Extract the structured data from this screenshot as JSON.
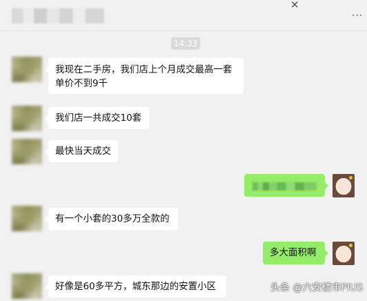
{
  "chat": {
    "timestamp": "14:33",
    "messages": [
      {
        "side": "left",
        "text": "我现在二手房，我们店上个月成交最高一套\n单价不到9千"
      },
      {
        "side": "left",
        "text": "我们店一共成交10套"
      },
      {
        "side": "left",
        "text": "最快当天成交"
      },
      {
        "side": "right",
        "text": ""
      },
      {
        "side": "left",
        "text": "有一个小套的30多万全款的"
      },
      {
        "side": "right",
        "text": "多大面积啊"
      },
      {
        "side": "left",
        "text": "好像是60多平方，城东那边的安置小区"
      }
    ]
  },
  "window": {
    "close_glyph": "✕",
    "more_glyph": "···"
  },
  "watermark": "头条 @六安楼市PIUS",
  "colors": {
    "background": "#f1f1f1",
    "incoming_bubble": "#ffffff",
    "outgoing_bubble": "#95ec69",
    "timestamp_bg": "#dadada"
  }
}
